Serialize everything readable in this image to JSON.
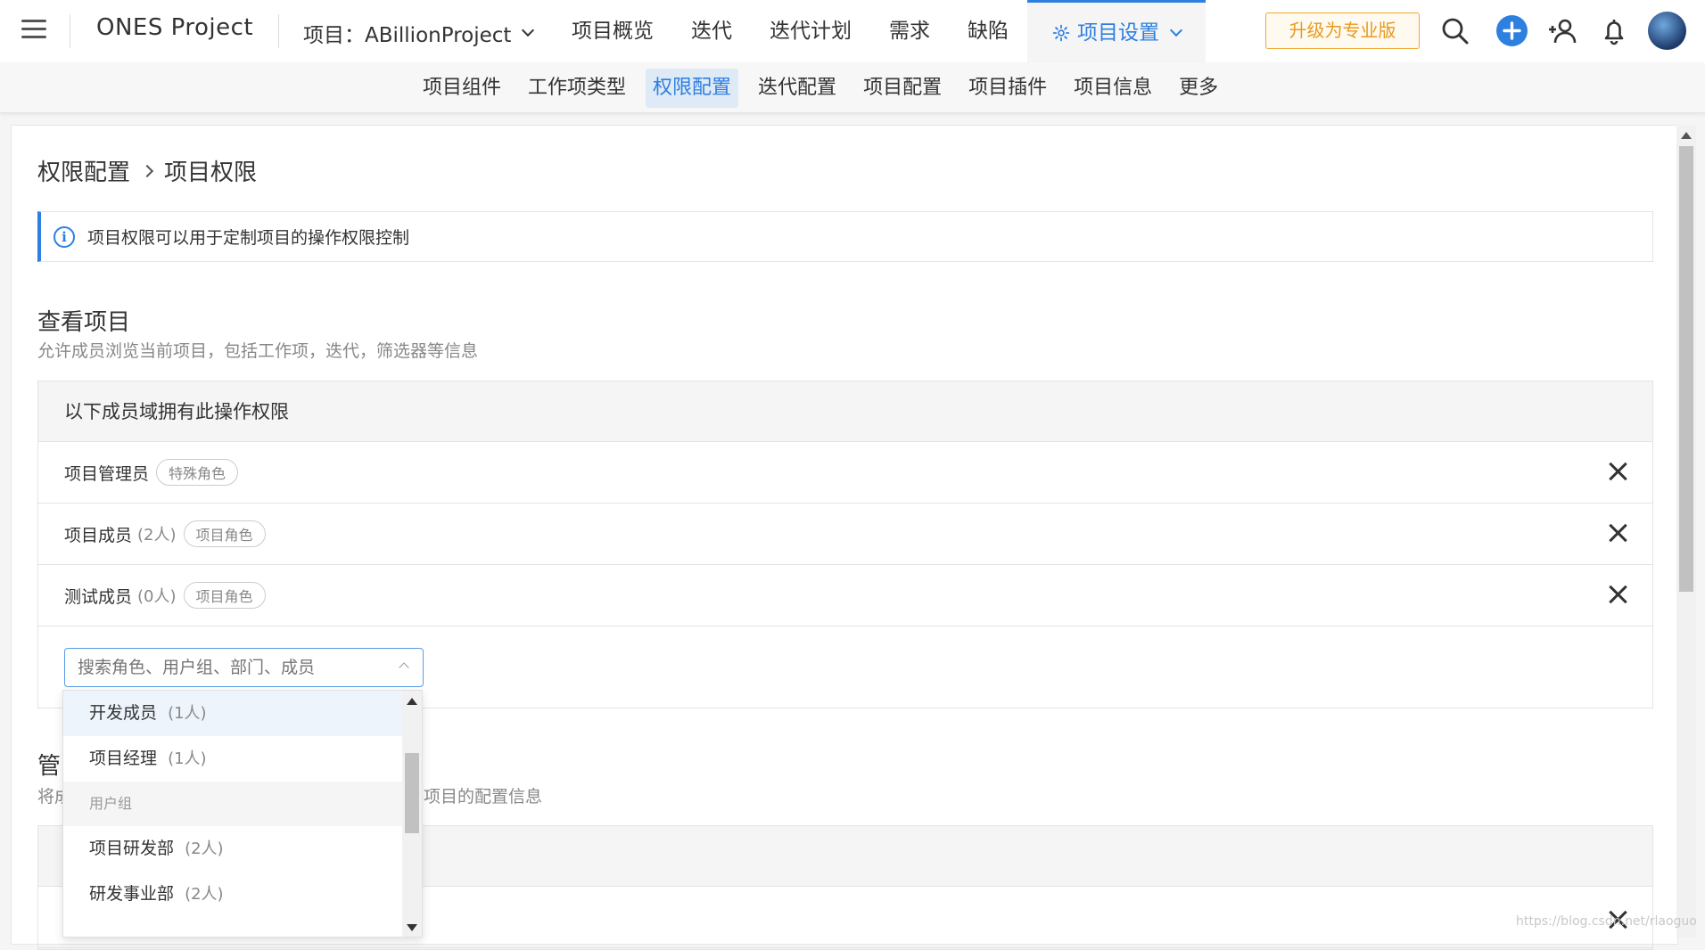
{
  "topbar": {
    "app_name": "ONES Project",
    "project_selector": "项目：ABillionProject",
    "nav": [
      "项目概览",
      "迭代",
      "迭代计划",
      "需求",
      "缺陷"
    ],
    "settings_label": "项目设置",
    "upgrade_label": "升级为专业版"
  },
  "subnav": {
    "tabs": [
      "项目组件",
      "工作项类型",
      "权限配置",
      "迭代配置",
      "项目配置",
      "项目插件",
      "项目信息",
      "更多"
    ],
    "active_index": 2
  },
  "breadcrumb": {
    "parent": "权限配置",
    "current": "项目权限"
  },
  "notice": {
    "text": "项目权限可以用于定制项目的操作权限控制"
  },
  "section_view": {
    "title": "查看项目",
    "description": "允许成员浏览当前项目，包括工作项，迭代，筛选器等信息",
    "box_header": "以下成员域拥有此操作权限",
    "rows": [
      {
        "name": "项目管理员",
        "count": "",
        "tag": "特殊角色"
      },
      {
        "name": "项目成员",
        "count": "(2人)",
        "tag": "项目角色"
      },
      {
        "name": "测试成员",
        "count": "(0人)",
        "tag": "项目角色"
      }
    ],
    "search_placeholder": "搜索角色、用户组、部门、成员"
  },
  "section_manage": {
    "title_partial": "管",
    "description_partial_left": "将成",
    "description_partial_right": "项目的配置信息"
  },
  "dropdown": {
    "items": [
      {
        "type": "item",
        "name": "开发成员",
        "count": "(1人)"
      },
      {
        "type": "item",
        "name": "项目经理",
        "count": "(1人)"
      },
      {
        "type": "group",
        "name": "用户组"
      },
      {
        "type": "item",
        "name": "项目研发部",
        "count": "(2人)"
      },
      {
        "type": "item",
        "name": "研发事业部",
        "count": "(2人)"
      }
    ]
  },
  "watermark": "https://blog.csdn.net/rlaoguo",
  "colors": {
    "accent": "#2d7fe0",
    "upgrade": "#e89a1e"
  }
}
